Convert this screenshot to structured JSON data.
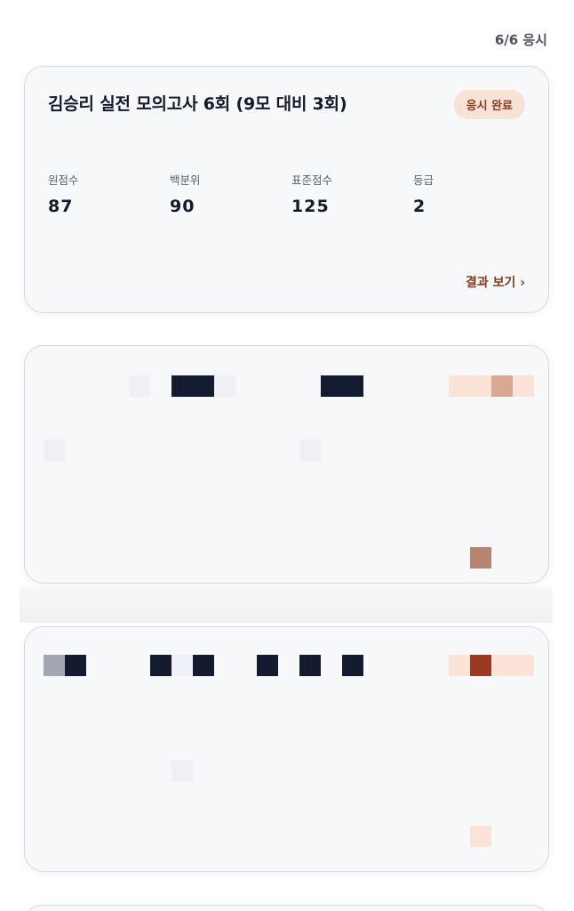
{
  "header": {
    "attempt_count": "6/6 응시"
  },
  "cards": [
    {
      "title": "김승리 실전 모의고사 6회 (9모 대비 3회)",
      "status": "응시 완료",
      "stats": [
        {
          "label": "원점수",
          "value": "87"
        },
        {
          "label": "백분위",
          "value": "90"
        },
        {
          "label": "표준점수",
          "value": "125"
        },
        {
          "label": "등급",
          "value": "2"
        }
      ],
      "link_label": "결과 보기 ›"
    }
  ],
  "colors": {
    "accent": "#8a3a1e",
    "badge_bg": "#f8e2d6",
    "card_bg": "#f6f8fa",
    "card_border": "#d6d9ec"
  }
}
